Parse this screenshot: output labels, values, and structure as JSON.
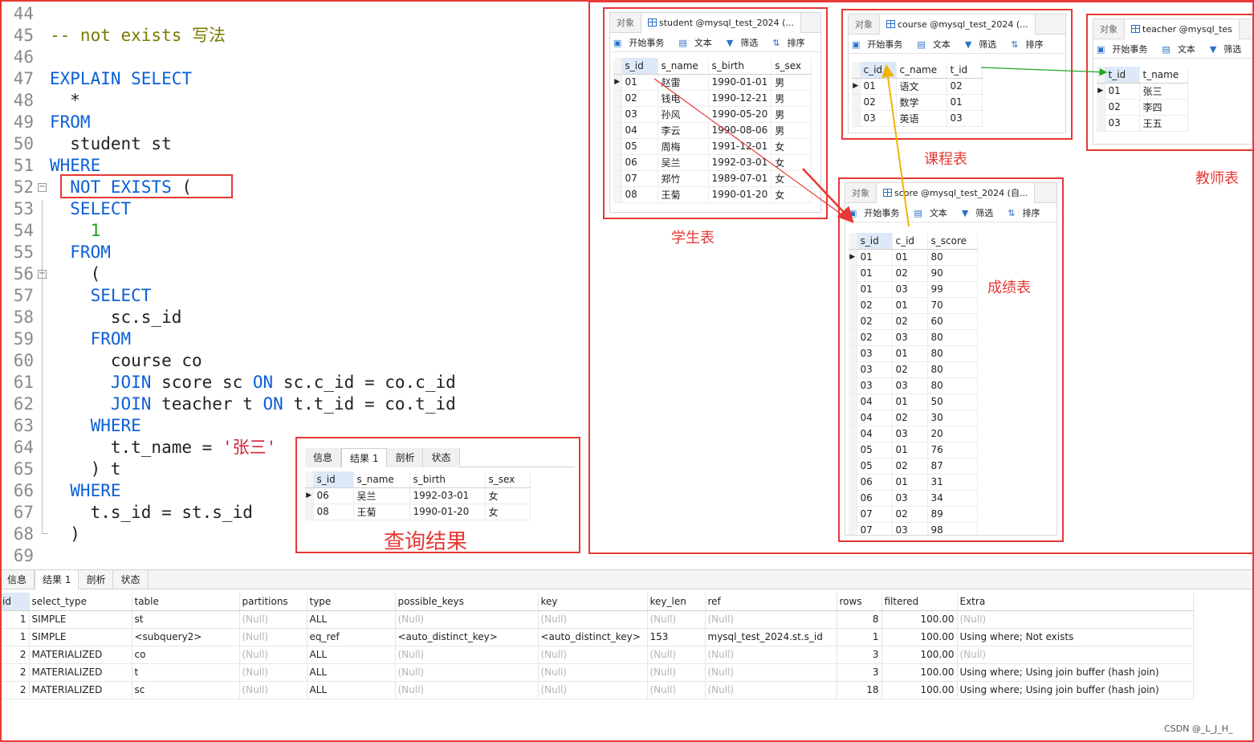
{
  "editor": {
    "lines": [
      {
        "n": "44",
        "tokens": []
      },
      {
        "n": "45",
        "tokens": [
          {
            "t": "-- not exists 写法",
            "c": "cm"
          }
        ]
      },
      {
        "n": "46",
        "tokens": []
      },
      {
        "n": "47",
        "tokens": [
          {
            "t": "EXPLAIN SELECT",
            "c": "kw"
          }
        ]
      },
      {
        "n": "48",
        "tokens": [
          {
            "t": "  *",
            "c": "pl"
          }
        ]
      },
      {
        "n": "49",
        "tokens": [
          {
            "t": "FROM",
            "c": "kw"
          }
        ]
      },
      {
        "n": "50",
        "tokens": [
          {
            "t": "  student st",
            "c": "pl"
          }
        ]
      },
      {
        "n": "51",
        "tokens": [
          {
            "t": "WHERE",
            "c": "kw"
          }
        ]
      },
      {
        "n": "52",
        "fold": "−",
        "tokens": [
          {
            "t": "  NOT EXISTS",
            "c": "kw"
          },
          {
            "t": " (",
            "c": "pl"
          }
        ]
      },
      {
        "n": "53",
        "tokens": [
          {
            "t": "  SELECT",
            "c": "kw"
          }
        ]
      },
      {
        "n": "54",
        "tokens": [
          {
            "t": "    1",
            "c": "num"
          }
        ]
      },
      {
        "n": "55",
        "tokens": [
          {
            "t": "  FROM",
            "c": "kw"
          }
        ]
      },
      {
        "n": "56",
        "fold": "−",
        "tokens": [
          {
            "t": "    (",
            "c": "pl"
          }
        ]
      },
      {
        "n": "57",
        "tokens": [
          {
            "t": "    SELECT",
            "c": "kw"
          }
        ]
      },
      {
        "n": "58",
        "tokens": [
          {
            "t": "      sc.s_id",
            "c": "pl"
          }
        ]
      },
      {
        "n": "59",
        "tokens": [
          {
            "t": "    FROM",
            "c": "kw"
          }
        ]
      },
      {
        "n": "60",
        "tokens": [
          {
            "t": "      course co",
            "c": "pl"
          }
        ]
      },
      {
        "n": "61",
        "tokens": [
          {
            "t": "      JOIN",
            "c": "kw"
          },
          {
            "t": " score sc ",
            "c": "pl"
          },
          {
            "t": "ON",
            "c": "kw"
          },
          {
            "t": " sc.c_id = co.c_id",
            "c": "pl"
          }
        ]
      },
      {
        "n": "62",
        "tokens": [
          {
            "t": "      JOIN",
            "c": "kw"
          },
          {
            "t": " teacher t ",
            "c": "pl"
          },
          {
            "t": "ON",
            "c": "kw"
          },
          {
            "t": " t.t_id = co.t_id",
            "c": "pl"
          }
        ]
      },
      {
        "n": "63",
        "tokens": [
          {
            "t": "    WHERE",
            "c": "kw"
          }
        ]
      },
      {
        "n": "64",
        "tokens": [
          {
            "t": "      t.t_name = ",
            "c": "pl"
          },
          {
            "t": "'张三'",
            "c": "str"
          }
        ]
      },
      {
        "n": "65",
        "tokens": [
          {
            "t": "    ) t",
            "c": "pl"
          }
        ]
      },
      {
        "n": "66",
        "tokens": [
          {
            "t": "  WHERE",
            "c": "kw"
          }
        ]
      },
      {
        "n": "67",
        "tokens": [
          {
            "t": "    t.s_id = st.s_id",
            "c": "pl"
          }
        ]
      },
      {
        "n": "68",
        "tokens": [
          {
            "t": "  )",
            "c": "pl"
          }
        ]
      },
      {
        "n": "69",
        "tokens": []
      }
    ]
  },
  "query_result": {
    "tabs": [
      "信息",
      "结果 1",
      "剖析",
      "状态"
    ],
    "active_tab": "结果 1",
    "columns": [
      "s_id",
      "s_name",
      "s_birth",
      "s_sex"
    ],
    "rows": [
      [
        "06",
        "吴兰",
        "1992-03-01",
        "女"
      ],
      [
        "08",
        "王菊",
        "1990-01-20",
        "女"
      ]
    ],
    "caption": "查询结果"
  },
  "toolbar": {
    "begin_tx": "开始事务",
    "text": "文本",
    "filter": "筛选",
    "sort": "排序",
    "objects_tab": "对象"
  },
  "student_win": {
    "tab": "student @mysql_test_2024 (...",
    "columns": [
      "s_id",
      "s_name",
      "s_birth",
      "s_sex"
    ],
    "rows": [
      [
        "01",
        "赵雷",
        "1990-01-01",
        "男"
      ],
      [
        "02",
        "钱电",
        "1990-12-21",
        "男"
      ],
      [
        "03",
        "孙风",
        "1990-05-20",
        "男"
      ],
      [
        "04",
        "李云",
        "1990-08-06",
        "男"
      ],
      [
        "05",
        "周梅",
        "1991-12-01",
        "女"
      ],
      [
        "06",
        "吴兰",
        "1992-03-01",
        "女"
      ],
      [
        "07",
        "郑竹",
        "1989-07-01",
        "女"
      ],
      [
        "08",
        "王菊",
        "1990-01-20",
        "女"
      ]
    ],
    "caption": "学生表"
  },
  "course_win": {
    "tab": "course @mysql_test_2024 (...",
    "columns": [
      "c_id",
      "c_name",
      "t_id"
    ],
    "rows": [
      [
        "01",
        "语文",
        "02"
      ],
      [
        "02",
        "数学",
        "01"
      ],
      [
        "03",
        "英语",
        "03"
      ]
    ],
    "caption": "课程表"
  },
  "teacher_win": {
    "tab": "teacher @mysql_tes",
    "columns": [
      "t_id",
      "t_name"
    ],
    "rows": [
      [
        "01",
        "张三"
      ],
      [
        "02",
        "李四"
      ],
      [
        "03",
        "王五"
      ]
    ],
    "caption": "教师表"
  },
  "score_win": {
    "tab": "score @mysql_test_2024 (自...",
    "columns": [
      "s_id",
      "c_id",
      "s_score"
    ],
    "rows": [
      [
        "01",
        "01",
        "80"
      ],
      [
        "01",
        "02",
        "90"
      ],
      [
        "01",
        "03",
        "99"
      ],
      [
        "02",
        "01",
        "70"
      ],
      [
        "02",
        "02",
        "60"
      ],
      [
        "02",
        "03",
        "80"
      ],
      [
        "03",
        "01",
        "80"
      ],
      [
        "03",
        "02",
        "80"
      ],
      [
        "03",
        "03",
        "80"
      ],
      [
        "04",
        "01",
        "50"
      ],
      [
        "04",
        "02",
        "30"
      ],
      [
        "04",
        "03",
        "20"
      ],
      [
        "05",
        "01",
        "76"
      ],
      [
        "05",
        "02",
        "87"
      ],
      [
        "06",
        "01",
        "31"
      ],
      [
        "06",
        "03",
        "34"
      ],
      [
        "07",
        "02",
        "89"
      ],
      [
        "07",
        "03",
        "98"
      ]
    ],
    "caption": "成绩表"
  },
  "explain": {
    "tabs": [
      "信息",
      "结果 1",
      "剖析",
      "状态"
    ],
    "active_tab": "结果 1",
    "columns": [
      "id",
      "select_type",
      "table",
      "partitions",
      "type",
      "possible_keys",
      "key",
      "key_len",
      "ref",
      "rows",
      "filtered",
      "Extra"
    ],
    "rows": [
      [
        "1",
        "SIMPLE",
        "st",
        "(Null)",
        "ALL",
        "(Null)",
        "(Null)",
        "(Null)",
        "(Null)",
        "8",
        "100.00",
        "(Null)"
      ],
      [
        "1",
        "SIMPLE",
        "<subquery2>",
        "(Null)",
        "eq_ref",
        "<auto_distinct_key>",
        "<auto_distinct_key>",
        "153",
        "mysql_test_2024.st.s_id",
        "1",
        "100.00",
        "Using where; Not exists"
      ],
      [
        "2",
        "MATERIALIZED",
        "co",
        "(Null)",
        "ALL",
        "(Null)",
        "(Null)",
        "(Null)",
        "(Null)",
        "3",
        "100.00",
        "(Null)"
      ],
      [
        "2",
        "MATERIALIZED",
        "t",
        "(Null)",
        "ALL",
        "(Null)",
        "(Null)",
        "(Null)",
        "(Null)",
        "3",
        "100.00",
        "Using where; Using join buffer (hash join)"
      ],
      [
        "2",
        "MATERIALIZED",
        "sc",
        "(Null)",
        "ALL",
        "(Null)",
        "(Null)",
        "(Null)",
        "(Null)",
        "18",
        "100.00",
        "Using where; Using join buffer (hash join)"
      ]
    ]
  },
  "watermark": "CSDN @_L_J_H_",
  "colors": {
    "annotation_red": "#e53935",
    "keyword_blue": "#0b5fd6",
    "arrow_green": "#1fa51f",
    "arrow_yellow": "#f0b400"
  }
}
